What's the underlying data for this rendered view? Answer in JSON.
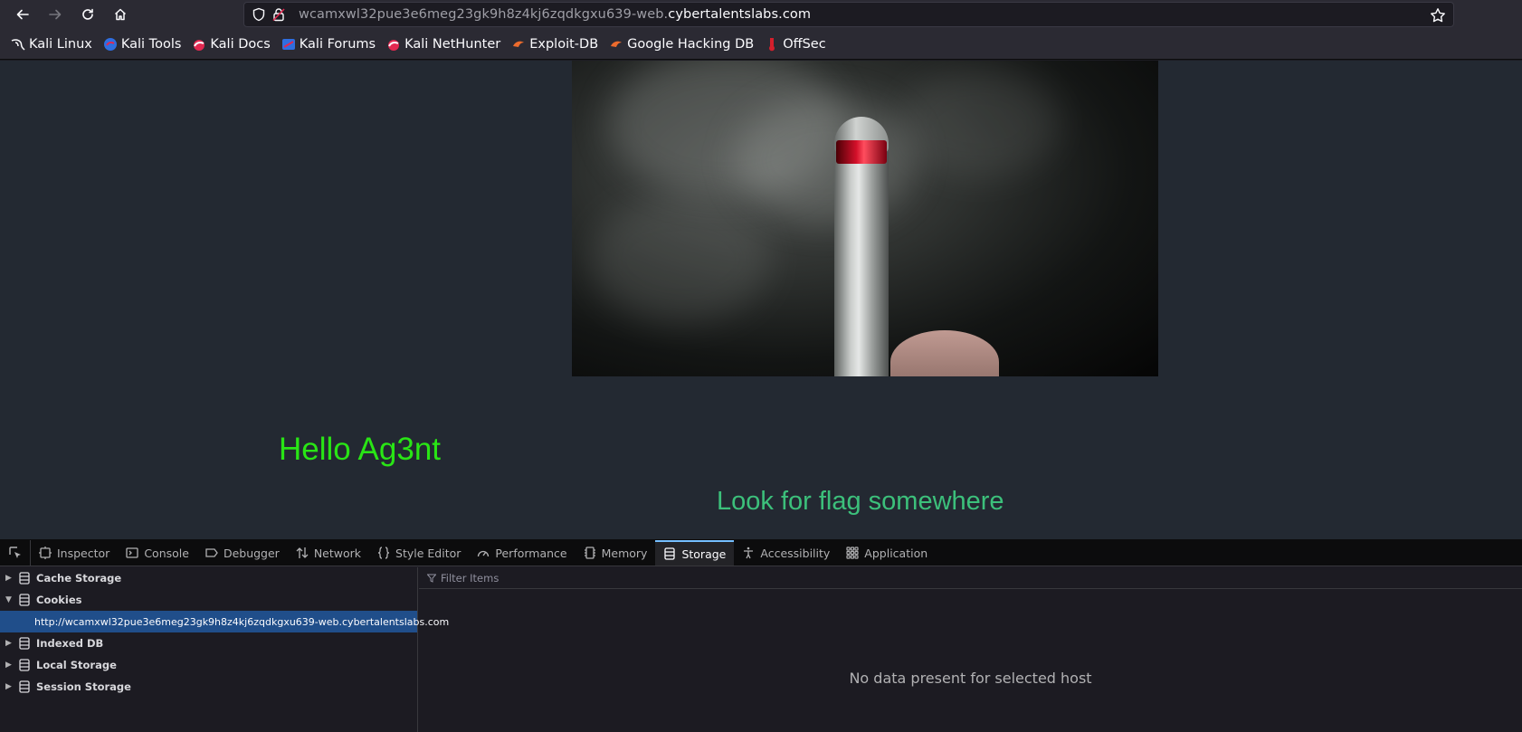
{
  "browser": {
    "url_prefix": "wcamxwl32pue3e6meg23gk9h8z4kj6zqdkgxu639-web.",
    "url_domain": "cybertalentslabs.com"
  },
  "bookmarks": [
    {
      "label": "Kali Linux",
      "icon": "kali-dragon-icon"
    },
    {
      "label": "Kali Tools",
      "icon": "kali-tools-icon"
    },
    {
      "label": "Kali Docs",
      "icon": "kali-docs-icon"
    },
    {
      "label": "Kali Forums",
      "icon": "kali-forums-icon"
    },
    {
      "label": "Kali NetHunter",
      "icon": "kali-nethunter-icon"
    },
    {
      "label": "Exploit-DB",
      "icon": "exploit-db-icon"
    },
    {
      "label": "Google Hacking DB",
      "icon": "ghdb-icon"
    },
    {
      "label": "OffSec",
      "icon": "offsec-icon"
    }
  ],
  "page": {
    "greeting": "Hello Ag3nt",
    "hint": "Look for flag somewhere"
  },
  "devtools": {
    "tabs": [
      "Inspector",
      "Console",
      "Debugger",
      "Network",
      "Style Editor",
      "Performance",
      "Memory",
      "Storage",
      "Accessibility",
      "Application"
    ],
    "active_tab": "Storage",
    "tree": {
      "cache_storage": "Cache Storage",
      "cookies": "Cookies",
      "cookie_host": "http://wcamxwl32pue3e6meg23gk9h8z4kj6zqdkgxu639-web.cybertalentslabs.com",
      "indexed_db": "Indexed DB",
      "local_storage": "Local Storage",
      "session_storage": "Session Storage"
    },
    "filter_placeholder": "Filter Items",
    "empty_message": "No data present for selected host"
  },
  "colors": {
    "greeting": "#29e515",
    "hint": "#3cc07b",
    "page_bg": "#232932",
    "selection": "#204e8a"
  }
}
